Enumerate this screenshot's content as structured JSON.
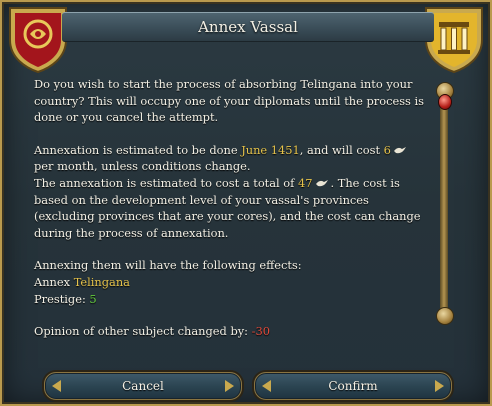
{
  "window": {
    "title": "Annex Vassal"
  },
  "icons": {
    "left_shield": "red-crest-shield-icon",
    "right_shield": "gold-pillars-shield-icon",
    "diplomat": "dove-icon"
  },
  "text": {
    "para1": "Do you wish to start the process of absorbing Telingana into your country? This will occupy one of your diplomats until the process is done or you cancel the attempt.",
    "est_prefix": "Annexation is estimated to be done ",
    "est_date": "June 1451",
    "est_middle": ", and will cost ",
    "est_cost": "6",
    "est_suffix": " per month, unless conditions change.",
    "total_prefix": "The annexation is estimated to cost a total of ",
    "total_cost": "47",
    "total_suffix": ". The cost is based on the development level of your vassal's provinces (excluding provinces that are your cores), and the cost can change during the process of annexation.",
    "effects_header": "Annexing them will have the following effects:",
    "annex_label": "Annex ",
    "annex_target": "Telingana",
    "prestige_label": "Prestige: ",
    "prestige_value": "5",
    "opinion_label": "Opinion of other subject changed by: ",
    "opinion_value": "-30"
  },
  "buttons": {
    "cancel": "Cancel",
    "confirm": "Confirm"
  },
  "colors": {
    "highlight_yellow": "#e6c34b",
    "positive_green": "#63c93e",
    "negative_red": "#e14a3a"
  }
}
